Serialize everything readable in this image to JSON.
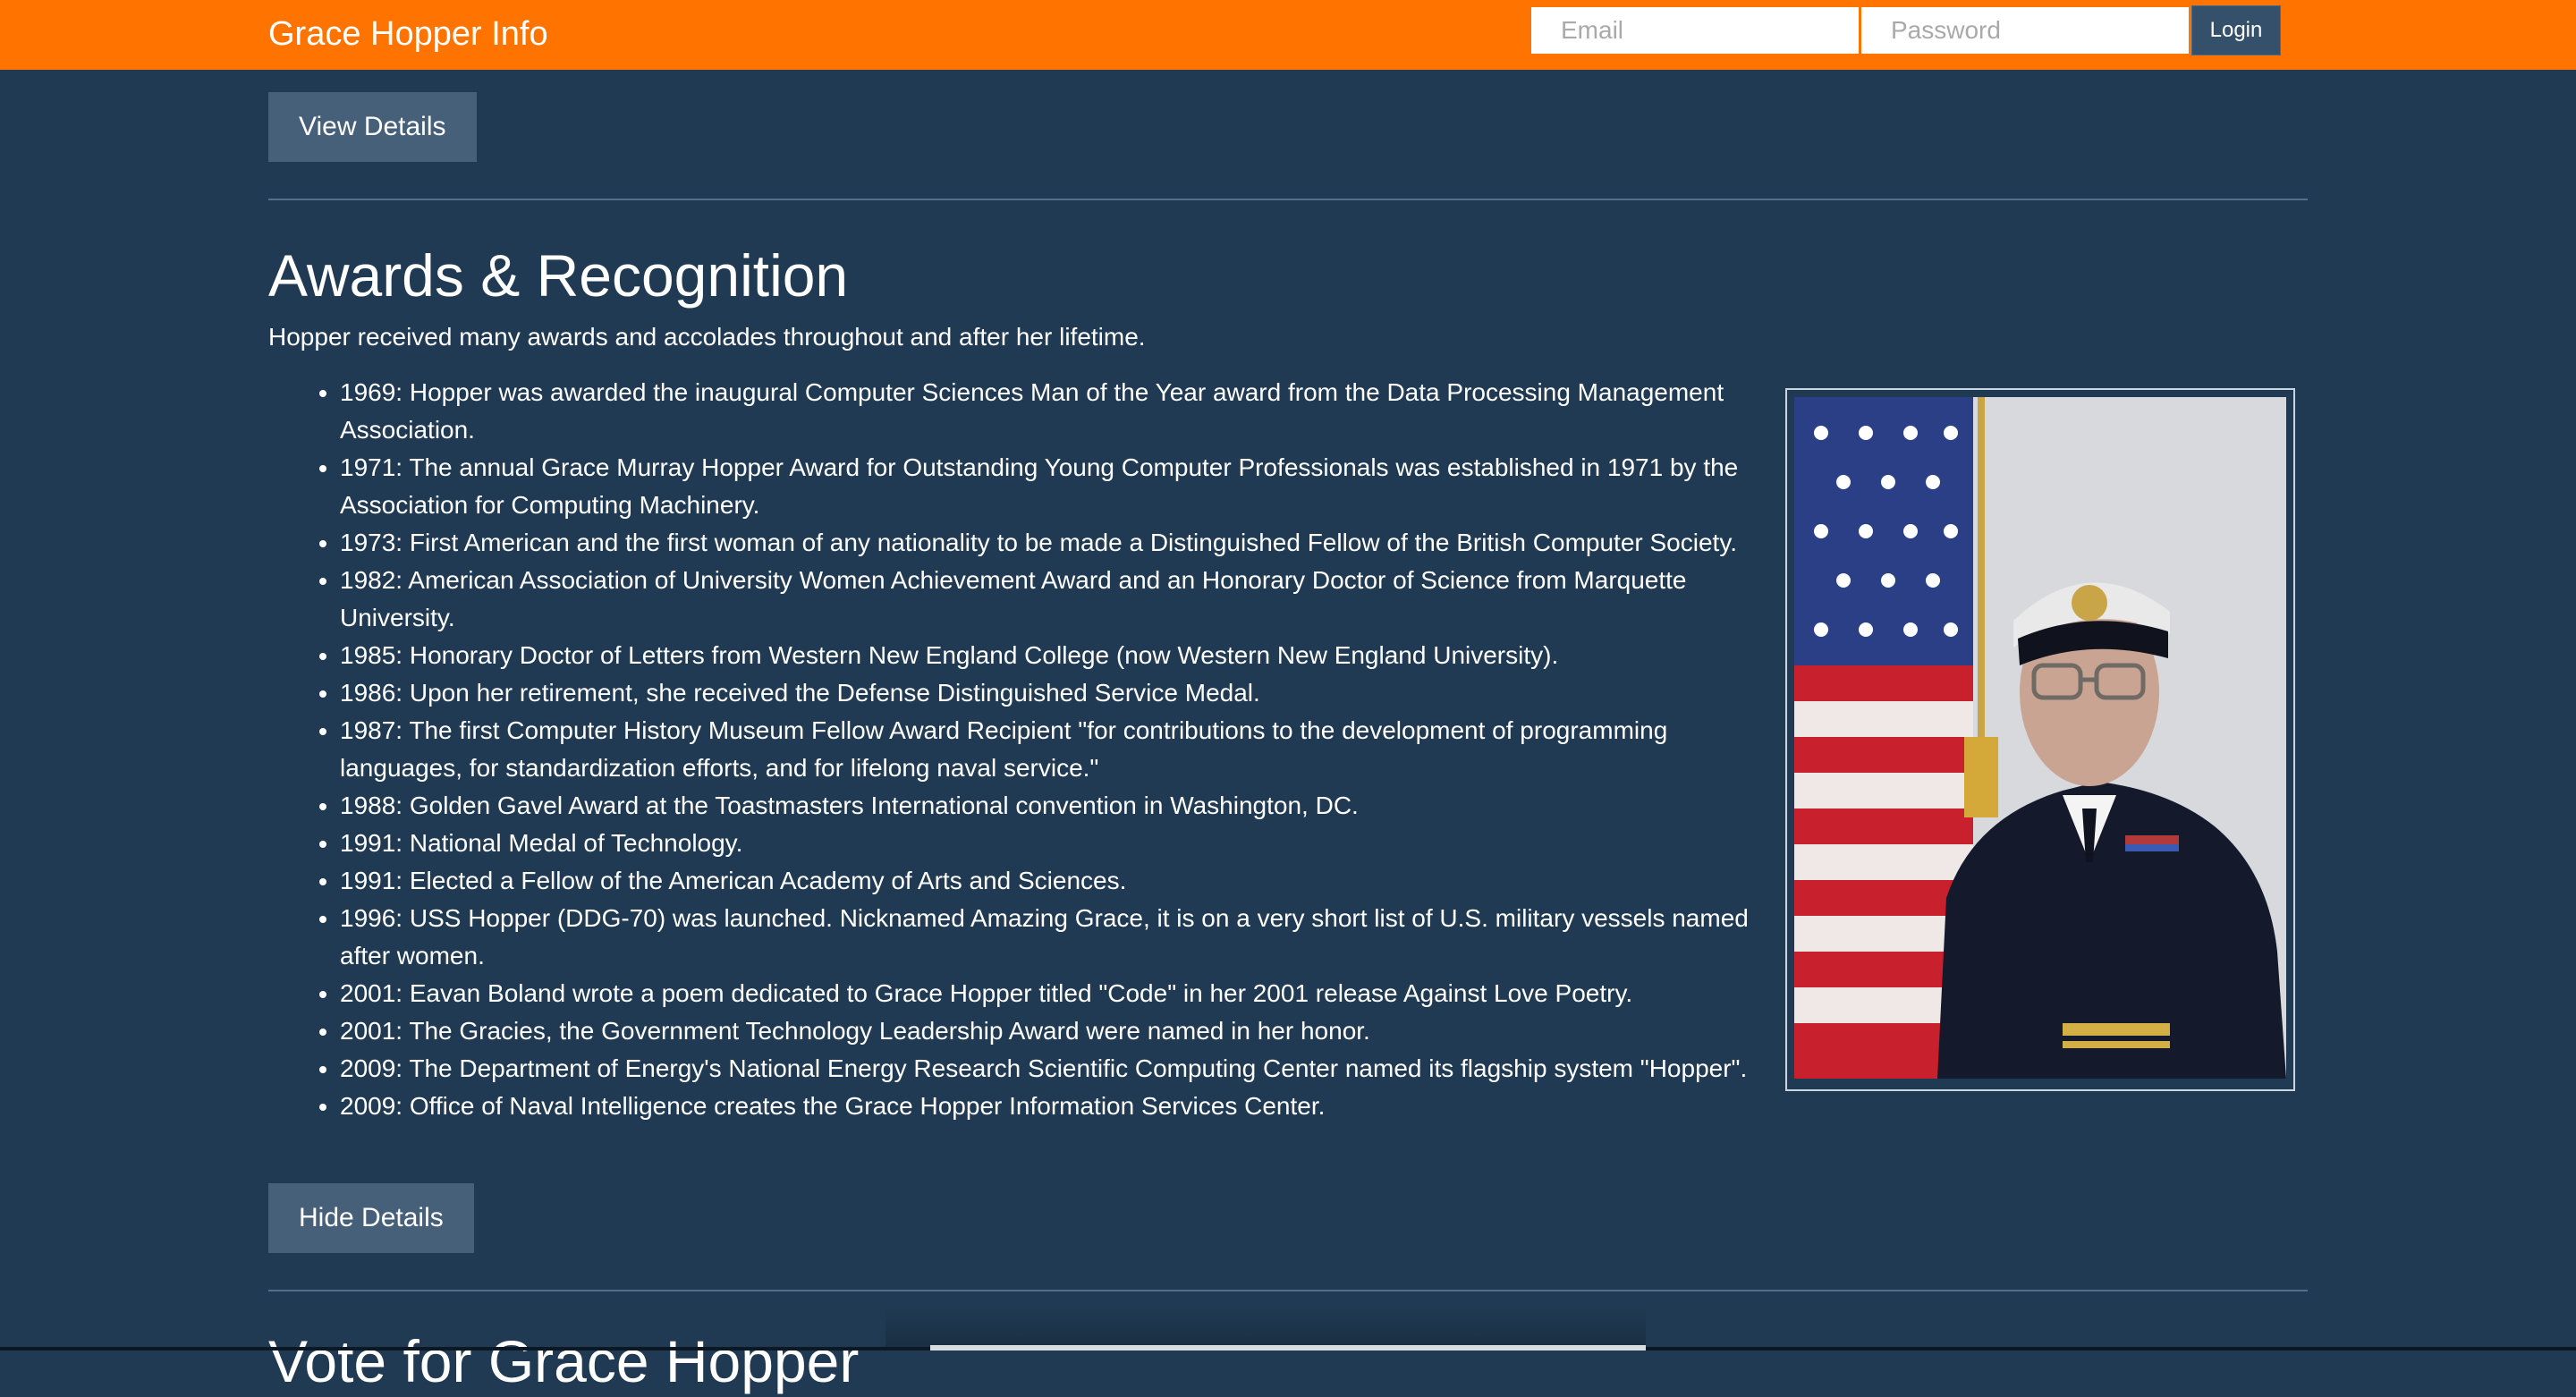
{
  "navbar": {
    "brand": "Grace Hopper Info",
    "email_placeholder": "Email",
    "password_placeholder": "Password",
    "login_label": "Login",
    "background_color": "#ff7400"
  },
  "page": {
    "background_color": "#1f3a52"
  },
  "buttons": {
    "view_details": "View Details",
    "hide_details": "Hide Details"
  },
  "awards": {
    "title": "Awards & Recognition",
    "intro": "Hopper received many awards and accolades throughout and after her lifetime.",
    "items": [
      "1969: Hopper was awarded the inaugural Computer Sciences Man of the Year award from the Data Processing Management Association.",
      "1971: The annual Grace Murray Hopper Award for Outstanding Young Computer Professionals was established in 1971 by the Association for Computing Machinery.",
      "1973: First American and the first woman of any nationality to be made a Distinguished Fellow of the British Computer Society.",
      "1982: American Association of University Women Achievement Award and an Honorary Doctor of Science from Marquette University.",
      "1985: Honorary Doctor of Letters from Western New England College (now Western New England University).",
      "1986: Upon her retirement, she received the Defense Distinguished Service Medal.",
      "1987: The first Computer History Museum Fellow Award Recipient \"for contributions to the development of programming languages, for standardization efforts, and for lifelong naval service.\"",
      "1988: Golden Gavel Award at the Toastmasters International convention in Washington, DC.",
      "1991: National Medal of Technology.",
      "1991: Elected a Fellow of the American Academy of Arts and Sciences.",
      "1996: USS Hopper (DDG-70) was launched. Nicknamed Amazing Grace, it is on a very short list of U.S. military vessels named after women.",
      "2001: Eavan Boland wrote a poem dedicated to Grace Hopper titled \"Code\" in her 2001 release Against Love Poetry.",
      "2001: The Gracies, the Government Technology Leadership Award were named in her honor.",
      "2009: The Department of Energy's National Energy Research Scientific Computing Center named its flagship system \"Hopper\".",
      "2009: Office of Naval Intelligence creates the Grace Hopper Information Services Center."
    ]
  },
  "next_section": {
    "title": "Vote for Grace Hopper"
  }
}
